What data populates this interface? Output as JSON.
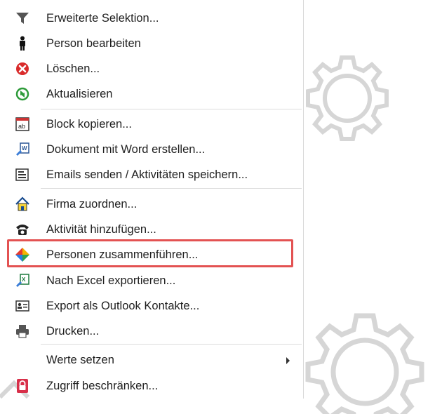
{
  "menu": {
    "items": [
      {
        "label": "Erweiterte Selektion...",
        "icon": "filter-icon"
      },
      {
        "label": "Person bearbeiten",
        "icon": "person-icon"
      },
      {
        "label": "Löschen...",
        "icon": "delete-icon"
      },
      {
        "label": "Aktualisieren",
        "icon": "refresh-icon"
      },
      {
        "label": "Block kopieren...",
        "icon": "copy-block-icon"
      },
      {
        "label": "Dokument mit Word erstellen...",
        "icon": "word-document-icon"
      },
      {
        "label": "Emails senden / Aktivitäten speichern...",
        "icon": "email-activity-icon"
      },
      {
        "label": "Firma zuordnen...",
        "icon": "house-icon"
      },
      {
        "label": "Aktivität hinzufügen...",
        "icon": "telephone-icon"
      },
      {
        "label": "Personen zusammenführen...",
        "icon": "merge-icon"
      },
      {
        "label": "Nach Excel exportieren...",
        "icon": "excel-export-icon"
      },
      {
        "label": "Export als Outlook Kontakte...",
        "icon": "contact-card-icon"
      },
      {
        "label": "Drucken...",
        "icon": "printer-icon"
      },
      {
        "label": "Werte setzen",
        "icon": "none"
      },
      {
        "label": "Zugriff beschränken...",
        "icon": "lock-icon"
      }
    ],
    "highlighted_item": "Personen zusammenführen...",
    "highlight_color": "#e35252"
  }
}
